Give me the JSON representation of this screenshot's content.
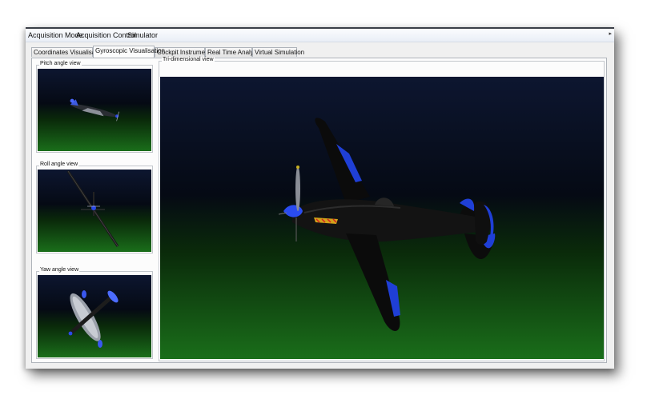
{
  "menubar": {
    "items": [
      "Acquisition Mode",
      "Acquisition Control",
      "Simulator"
    ],
    "overflow_icon": "chevron-right-icon"
  },
  "tabs": {
    "items": [
      "Coordinates Visualisation",
      "Gyroscopic Visualisation",
      "Cockpit Instruments",
      "Real Time Analysis",
      "Virtual Simulation"
    ],
    "active": "Gyroscopic Visualisation"
  },
  "views": {
    "pitch_label": "Pitch angle view",
    "roll_label": "Roll angle view",
    "yaw_label": "Yaw angle view",
    "tri_label": "Tri-dimensional view"
  },
  "colors": {
    "sky_top": "#0d1630",
    "ground": "#1a6e1a",
    "aircraft_body": "#111111",
    "aircraft_accent": "#1f3fd6",
    "exhaust": "#ffcc00"
  }
}
